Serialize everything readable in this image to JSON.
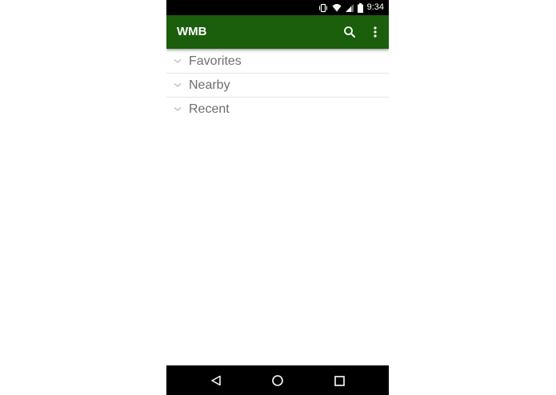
{
  "status_bar": {
    "time": "9:34",
    "icons": [
      "vibrate-icon",
      "wifi-icon",
      "signal-icon",
      "battery-icon"
    ]
  },
  "app_bar": {
    "title": "WMB",
    "background_color": "#1b5e0c",
    "actions": [
      "search-icon",
      "more-vert-icon"
    ]
  },
  "list": {
    "groups": [
      {
        "label": "Favorites"
      },
      {
        "label": "Nearby"
      },
      {
        "label": "Recent"
      }
    ]
  },
  "nav_bar": {
    "buttons": [
      "back-icon",
      "home-icon",
      "recents-icon"
    ]
  }
}
